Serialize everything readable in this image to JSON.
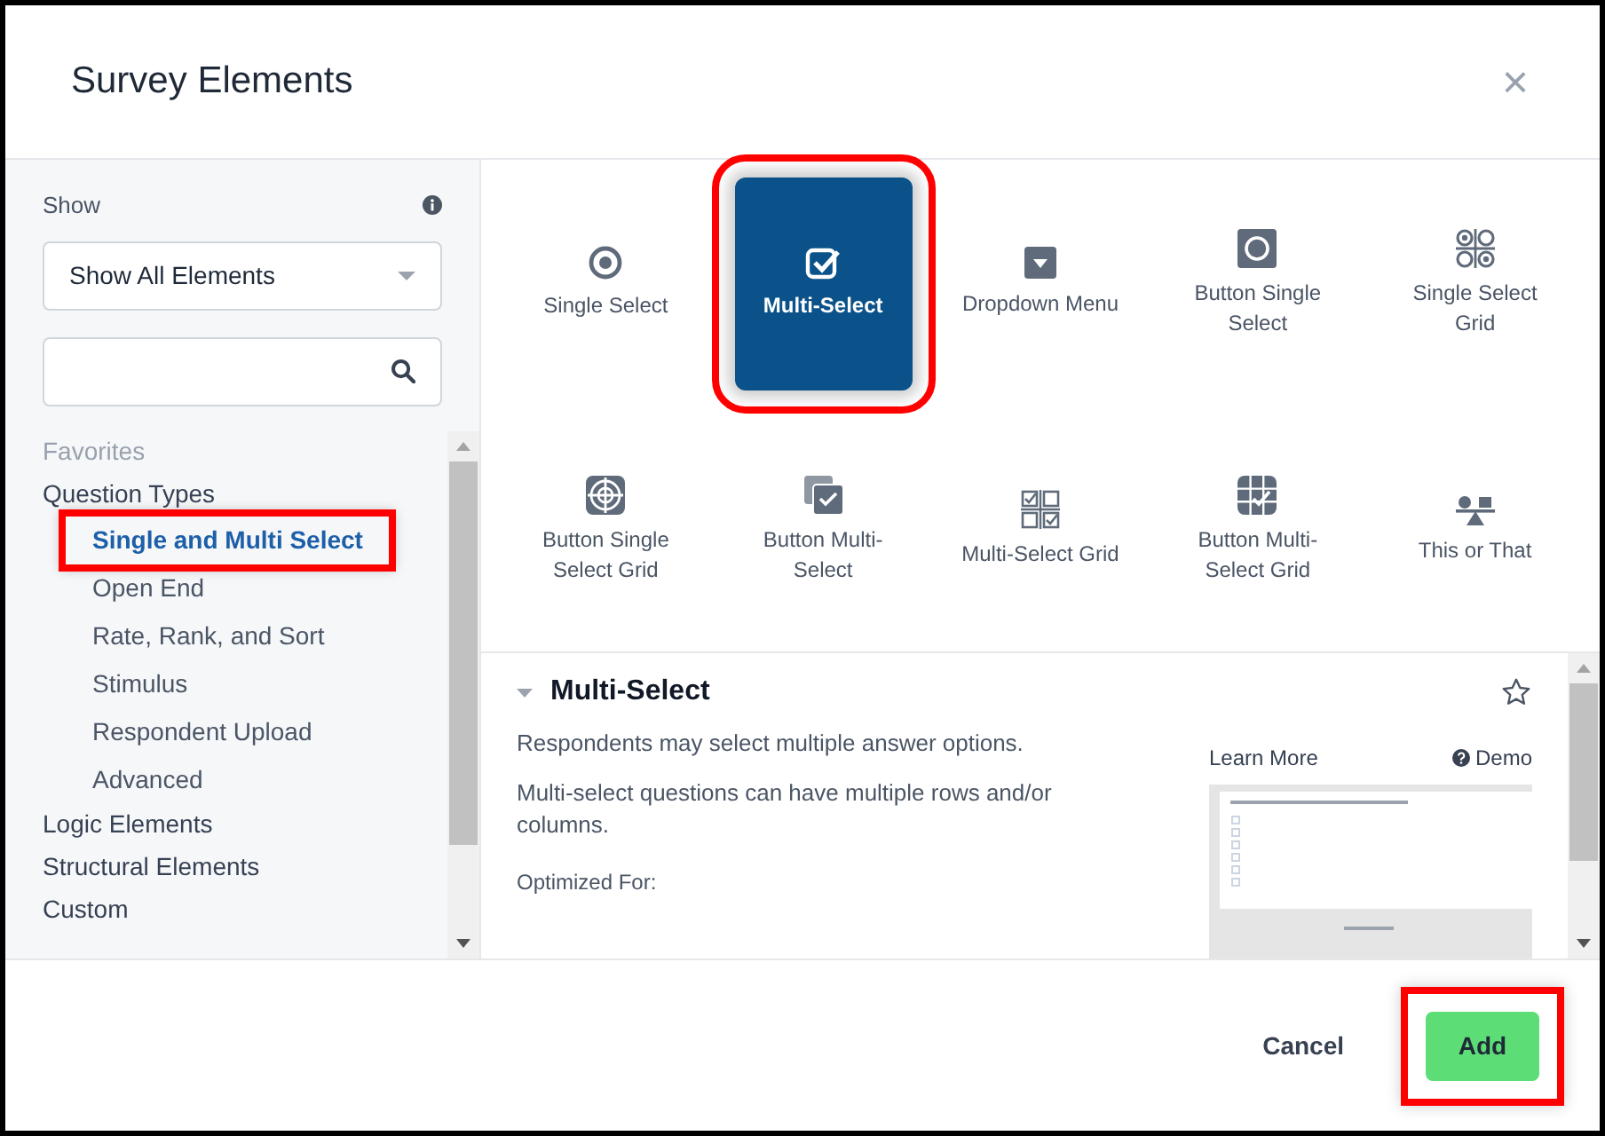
{
  "dialog": {
    "title": "Survey Elements",
    "close": "×"
  },
  "sidebar": {
    "show_label": "Show",
    "filter": {
      "value": "Show All Elements"
    },
    "categories": [
      {
        "label": "Favorites",
        "disabled": true
      },
      {
        "label": "Question Types",
        "disabled": false,
        "children": [
          {
            "label": "Single and Multi Select",
            "selected": true,
            "highlighted": true
          },
          {
            "label": "Open End",
            "selected": false,
            "highlighted": false
          },
          {
            "label": "Rate, Rank, and Sort",
            "selected": false,
            "highlighted": false
          },
          {
            "label": "Stimulus",
            "selected": false,
            "highlighted": false
          },
          {
            "label": "Respondent Upload",
            "selected": false,
            "highlighted": false
          },
          {
            "label": "Advanced",
            "selected": false,
            "highlighted": false
          }
        ]
      },
      {
        "label": "Logic Elements",
        "disabled": false
      },
      {
        "label": "Structural Elements",
        "disabled": false
      },
      {
        "label": "Custom",
        "disabled": false
      }
    ]
  },
  "elements": [
    {
      "label": "Single Select",
      "selected": false,
      "highlighted": false
    },
    {
      "label": "Multi-Select",
      "selected": true,
      "highlighted": true
    },
    {
      "label": "Dropdown Menu",
      "selected": false,
      "highlighted": false
    },
    {
      "label": "Button Single Select",
      "selected": false,
      "highlighted": false
    },
    {
      "label": "Single Select Grid",
      "selected": false,
      "highlighted": false
    },
    {
      "label": "Button Single Select Grid",
      "selected": false,
      "highlighted": false
    },
    {
      "label": "Button Multi-Select",
      "selected": false,
      "highlighted": false
    },
    {
      "label": "Multi-Select Grid",
      "selected": false,
      "highlighted": false
    },
    {
      "label": "Button Multi-Select Grid",
      "selected": false,
      "highlighted": false
    },
    {
      "label": "This or That",
      "selected": false,
      "highlighted": false
    }
  ],
  "detail": {
    "title": "Multi-Select",
    "expanded": true,
    "favorite": false,
    "paragraphs": [
      "Respondents may select multiple answer options.",
      "Multi-select questions can have multiple rows and/or columns."
    ],
    "optimized_for": "Optimized For:",
    "learn_more": "Learn More",
    "demo": "Demo"
  },
  "footer": {
    "cancel": "Cancel",
    "add": {
      "label": "Add",
      "highlighted": true
    }
  }
}
